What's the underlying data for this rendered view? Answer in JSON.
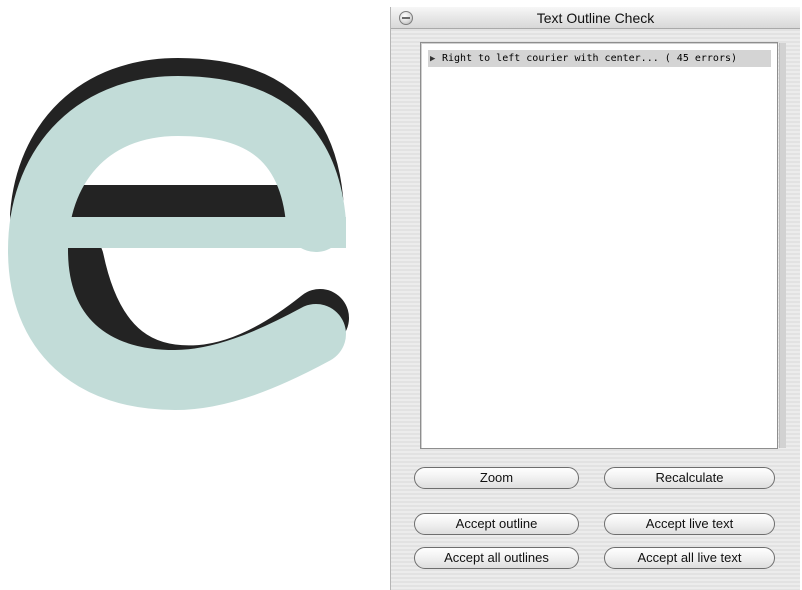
{
  "window": {
    "title": "Text Outline Check"
  },
  "errors_list": {
    "items": [
      {
        "label": "Right to left courier with center... ( 45 errors)",
        "disclosure": "▶"
      }
    ]
  },
  "buttons": {
    "zoom": "Zoom",
    "recalculate": "Recalculate",
    "accept_outline": "Accept outline",
    "accept_live_text": "Accept live text",
    "accept_all_outlines": "Accept all outlines",
    "accept_all_live_text": "Accept all live text"
  },
  "artwork": {
    "glyph_fill": "#c2dcd8",
    "glyph_shadow": "#232323"
  },
  "icons": {
    "collapse": "window-collapse-icon",
    "disclosure": "disclosure-triangle-icon"
  }
}
